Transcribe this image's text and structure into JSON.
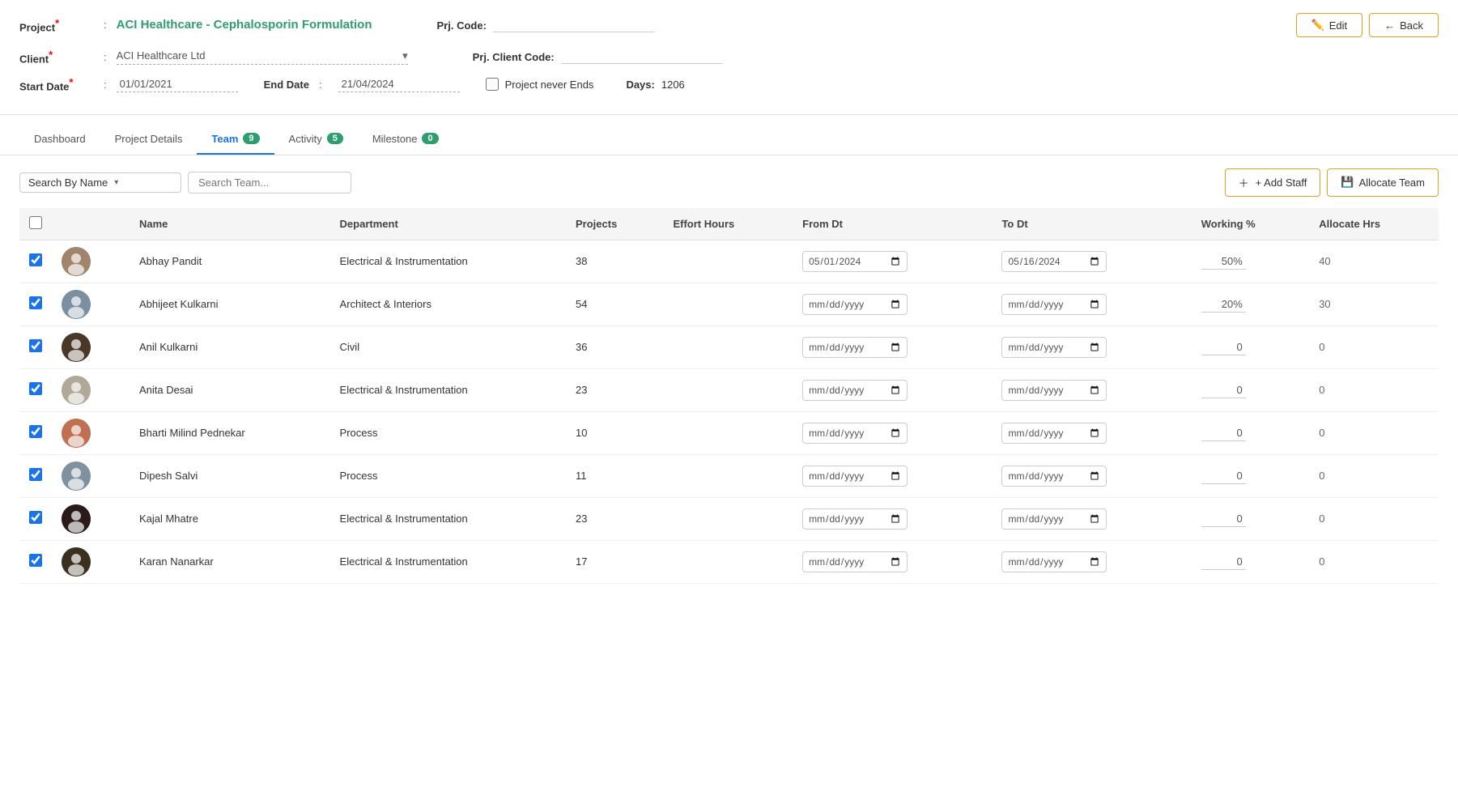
{
  "project": {
    "label": "Project",
    "colon": ":",
    "name": "ACI Healthcare - Cephalosporin Formulation",
    "code_label": "Prj. Code:",
    "code_value": "",
    "client_label": "Client",
    "client_value": "ACI Healthcare Ltd",
    "client_code_label": "Prj. Client Code:",
    "client_code_value": "",
    "start_date_label": "Start Date",
    "start_date_value": "01/01/2021",
    "end_date_label": "End Date",
    "end_date_value": "21/04/2024",
    "never_ends_label": "Project never Ends",
    "days_label": "Days:",
    "days_value": "1206"
  },
  "buttons": {
    "edit_label": "Edit",
    "back_label": "Back",
    "add_staff_label": "+ Add Staff",
    "allocate_team_label": "Allocate Team"
  },
  "tabs": [
    {
      "id": "dashboard",
      "label": "Dashboard",
      "badge": null,
      "active": false
    },
    {
      "id": "project-details",
      "label": "Project Details",
      "badge": null,
      "active": false
    },
    {
      "id": "team",
      "label": "Team",
      "badge": "9",
      "active": true
    },
    {
      "id": "activity",
      "label": "Activity",
      "badge": "5",
      "active": false
    },
    {
      "id": "milestone",
      "label": "Milestone",
      "badge": "0",
      "active": false
    }
  ],
  "search": {
    "by_label": "Search By Name",
    "placeholder": "Search Team..."
  },
  "table": {
    "headers": [
      "",
      "",
      "Name",
      "Department",
      "Projects",
      "Effort Hours",
      "From Dt",
      "To Dt",
      "Working %",
      "Allocate Hrs"
    ],
    "rows": [
      {
        "checked": true,
        "name": "Abhay Pandit",
        "department": "Electrical & Instrumentation",
        "projects": "38",
        "effort_hours": "",
        "from_dt": "01/05/2024",
        "to_dt": "16/05/2024",
        "working_pct": "50%",
        "allocate_hrs": "40",
        "avatar_color": "#a0856c"
      },
      {
        "checked": true,
        "name": "Abhijeet Kulkarni",
        "department": "Architect & Interiors",
        "projects": "54",
        "effort_hours": "",
        "from_dt": "dd/mm/yyyy",
        "to_dt": "dd/mm/yyyy",
        "working_pct": "20%",
        "allocate_hrs": "30",
        "avatar_color": "#7a8fa0"
      },
      {
        "checked": true,
        "name": "Anil Kulkarni",
        "department": "Civil",
        "projects": "36",
        "effort_hours": "",
        "from_dt": "dd/mm/yyyy",
        "to_dt": "dd/mm/yyyy",
        "working_pct": "0",
        "allocate_hrs": "0",
        "avatar_color": "#4a3728"
      },
      {
        "checked": true,
        "name": "Anita Desai",
        "department": "Electrical & Instrumentation",
        "projects": "23",
        "effort_hours": "",
        "from_dt": "dd/mm/yyyy",
        "to_dt": "dd/mm/yyyy",
        "working_pct": "0",
        "allocate_hrs": "0",
        "avatar_color": "#b0a898"
      },
      {
        "checked": true,
        "name": "Bharti Milind Pednekar",
        "department": "Process",
        "projects": "10",
        "effort_hours": "",
        "from_dt": "dd/mm/yyyy",
        "to_dt": "dd/mm/yyyy",
        "working_pct": "0",
        "allocate_hrs": "0",
        "avatar_color": "#c07050"
      },
      {
        "checked": true,
        "name": "Dipesh Salvi",
        "department": "Process",
        "projects": "11",
        "effort_hours": "",
        "from_dt": "dd/mm/yyyy",
        "to_dt": "dd/mm/yyyy",
        "working_pct": "0",
        "allocate_hrs": "0",
        "avatar_color": "#8090a0"
      },
      {
        "checked": true,
        "name": "Kajal Mhatre",
        "department": "Electrical & Instrumentation",
        "projects": "23",
        "effort_hours": "",
        "from_dt": "dd/mm/yyyy",
        "to_dt": "dd/mm/yyyy",
        "working_pct": "0",
        "allocate_hrs": "0",
        "avatar_color": "#2a1a1a"
      },
      {
        "checked": true,
        "name": "Karan Nanarkar",
        "department": "Electrical & Instrumentation",
        "projects": "17",
        "effort_hours": "",
        "from_dt": "dd/mm/yyyy",
        "to_dt": "dd/mm/yyyy",
        "working_pct": "0",
        "allocate_hrs": "0",
        "avatar_color": "#3a3020"
      }
    ]
  }
}
